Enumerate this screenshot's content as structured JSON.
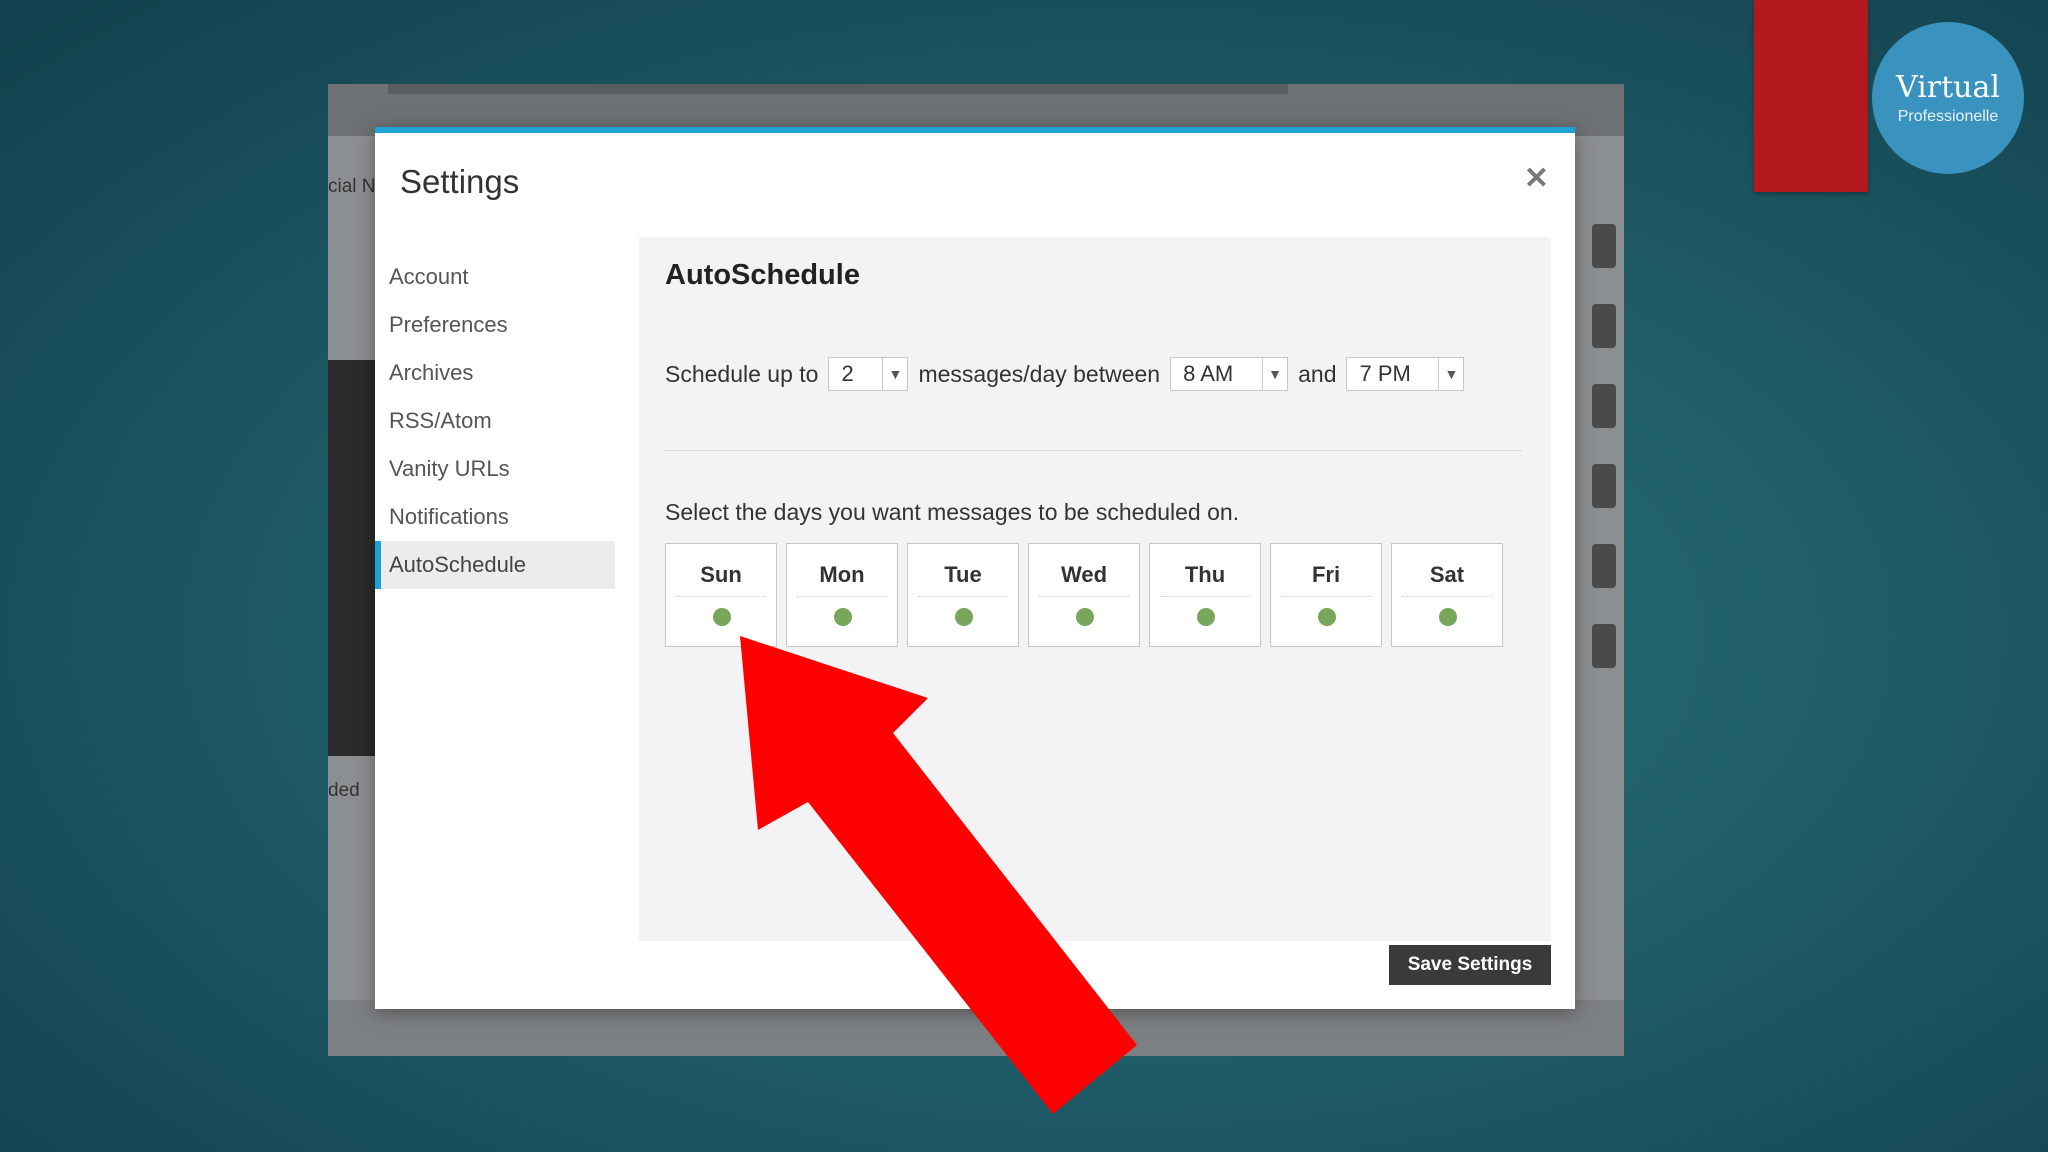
{
  "background_app": {
    "tab_fragment": "cial N",
    "side_fragment": "ded"
  },
  "brand": {
    "name": "Virtual",
    "tagline": "Professionelle",
    "color": "#3a93bf",
    "red_block_color": "#b3191c"
  },
  "modal": {
    "title": "Settings",
    "close_icon": "close-icon",
    "accent_color": "#1da1d6"
  },
  "sidebar": {
    "items": [
      {
        "label": "Account",
        "active": false
      },
      {
        "label": "Preferences",
        "active": false
      },
      {
        "label": "Archives",
        "active": false
      },
      {
        "label": "RSS/Atom",
        "active": false
      },
      {
        "label": "Vanity URLs",
        "active": false
      },
      {
        "label": "Notifications",
        "active": false
      },
      {
        "label": "AutoSchedule",
        "active": true
      }
    ]
  },
  "autoschedule": {
    "title": "AutoSchedule",
    "schedule_prefix": "Schedule up to",
    "count_value": "2",
    "schedule_middle": "messages/day between",
    "start_time": "8 AM",
    "and_text": "and",
    "end_time": "7 PM",
    "days_prompt": "Select the days you want messages to be scheduled on.",
    "days": [
      {
        "label": "Sun",
        "enabled": true
      },
      {
        "label": "Mon",
        "enabled": true
      },
      {
        "label": "Tue",
        "enabled": true
      },
      {
        "label": "Wed",
        "enabled": true
      },
      {
        "label": "Thu",
        "enabled": true
      },
      {
        "label": "Fri",
        "enabled": true
      },
      {
        "label": "Sat",
        "enabled": true
      }
    ],
    "enabled_dot_color": "#78a65a",
    "save_label": "Save Settings"
  },
  "annotation": {
    "arrow_color": "#ff0000"
  }
}
